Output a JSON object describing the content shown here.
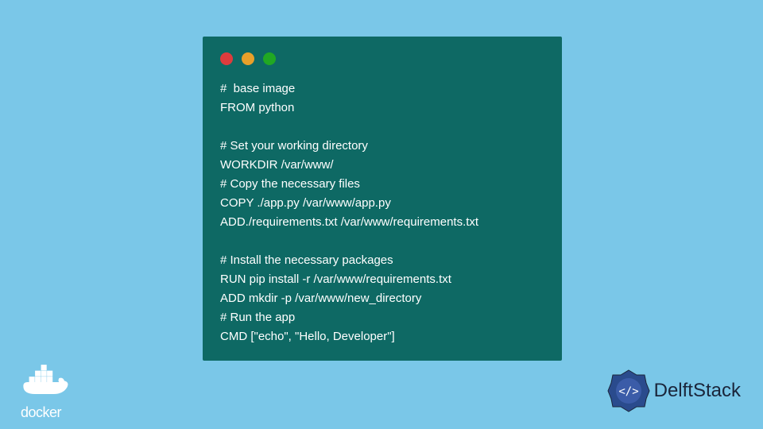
{
  "code": {
    "lines": [
      "#  base image",
      "FROM python",
      "",
      "# Set your working directory",
      "WORKDIR /var/www/",
      "# Copy the necessary files",
      "COPY ./app.py /var/www/app.py",
      "ADD./requirements.txt /var/www/requirements.txt",
      "",
      "# Install the necessary packages",
      "RUN pip install -r /var/www/requirements.txt",
      "ADD mkdir -p /var/www/new_directory",
      "# Run the app",
      "CMD [\"echo\", \"Hello, Developer\"]"
    ]
  },
  "logos": {
    "docker_text": "docker",
    "delftstack_text": "DelftStack"
  },
  "colors": {
    "background": "#7ac7e8",
    "window": "#0e6964",
    "red": "#de3c3d",
    "yellow": "#e8a02a",
    "green": "#21a823"
  }
}
